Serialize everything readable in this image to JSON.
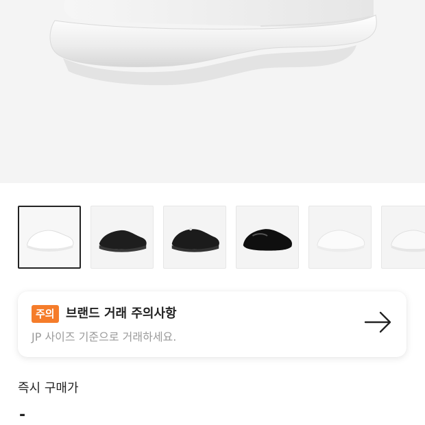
{
  "product": {
    "hero_image": "white-sneaker-sole-closeup",
    "thumbnails": [
      {
        "label": "white sneaker side view",
        "selected": true,
        "color": "white"
      },
      {
        "label": "black sneaker side view",
        "selected": false,
        "color": "black"
      },
      {
        "label": "black sneaker laced view",
        "selected": false,
        "color": "black"
      },
      {
        "label": "black glossy sneaker view",
        "selected": false,
        "color": "black"
      },
      {
        "label": "white sneaker rear view",
        "selected": false,
        "color": "white"
      },
      {
        "label": "white sneaker alternate view",
        "selected": false,
        "color": "white"
      }
    ]
  },
  "notice": {
    "badge": "주의",
    "title": "브랜드 거래 주의사항",
    "subtitle": "JP 사이즈 기준으로 거래하세요.",
    "arrow_icon": "arrow-right-icon"
  },
  "price": {
    "label": "즉시 구매가",
    "value": "-"
  },
  "colors": {
    "badge": "#f57c2a",
    "background": "#f4f4f4",
    "text": "#222222",
    "subtext": "#9a9a9a"
  }
}
